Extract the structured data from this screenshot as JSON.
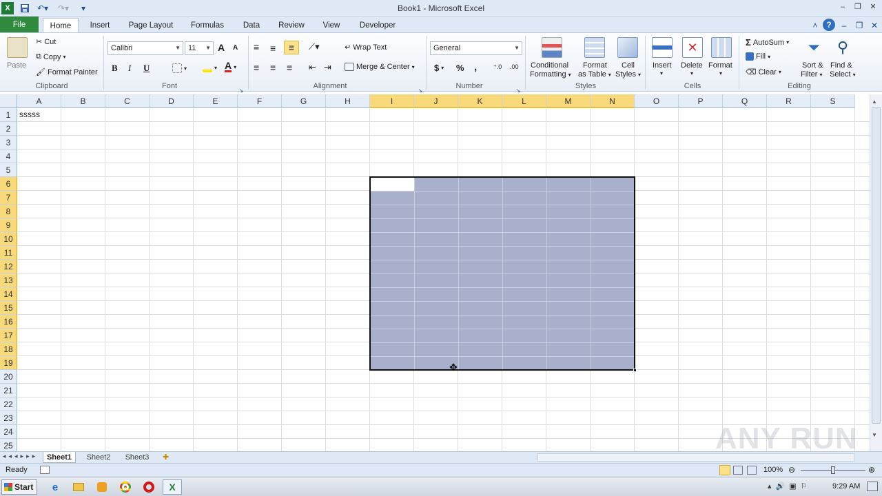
{
  "app": {
    "title": "Book1 - Microsoft Excel",
    "window_controls": [
      "–",
      "❐",
      "✕"
    ]
  },
  "tabs": [
    {
      "label": "File"
    },
    {
      "label": "Home"
    },
    {
      "label": "Insert"
    },
    {
      "label": "Page Layout"
    },
    {
      "label": "Formulas"
    },
    {
      "label": "Data"
    },
    {
      "label": "Review"
    },
    {
      "label": "View"
    },
    {
      "label": "Developer"
    }
  ],
  "ribbon": {
    "clipboard": {
      "paste": "Paste",
      "cut": "Cut",
      "copy": "Copy",
      "format_painter": "Format Painter",
      "label": "Clipboard"
    },
    "font": {
      "name": "Calibri",
      "size": "11",
      "label": "Font",
      "bold": "B",
      "italic": "I",
      "underline": "U",
      "grow": "A",
      "shrink": "A",
      "font_color": "A"
    },
    "alignment": {
      "wrap_text": "Wrap Text",
      "merge_center": "Merge & Center",
      "label": "Alignment"
    },
    "number": {
      "format": "General",
      "currency": "$",
      "percent": "%",
      "comma": ",",
      "label": "Number"
    },
    "styles": {
      "conditional": "Conditional",
      "conditional2": "Formatting",
      "format_as": "Format",
      "format_as2": "as Table",
      "cell": "Cell",
      "cell2": "Styles",
      "label": "Styles"
    },
    "cells": {
      "insert": "Insert",
      "delete": "Delete",
      "format": "Format",
      "label": "Cells"
    },
    "editing": {
      "autosum": "AutoSum",
      "fill": "Fill",
      "clear": "Clear",
      "sort": "Sort &",
      "sort2": "Filter",
      "find": "Find &",
      "find2": "Select",
      "label": "Editing"
    }
  },
  "sheet": {
    "columns": [
      "A",
      "B",
      "C",
      "D",
      "E",
      "F",
      "G",
      "H",
      "I",
      "J",
      "K",
      "L",
      "M",
      "N",
      "O",
      "P",
      "Q",
      "R",
      "S"
    ],
    "rows": [
      "1",
      "2",
      "3",
      "4",
      "5",
      "6",
      "7",
      "8",
      "9",
      "10",
      "11",
      "12",
      "13",
      "14",
      "15",
      "16",
      "17",
      "18",
      "19",
      "20",
      "21",
      "22",
      "23",
      "24",
      "25"
    ],
    "selected_columns": [
      "I",
      "J",
      "K",
      "L",
      "M",
      "N"
    ],
    "selected_rows": [
      "6",
      "7",
      "8",
      "9",
      "10",
      "11",
      "12",
      "13",
      "14",
      "15",
      "16",
      "17",
      "18",
      "19"
    ],
    "cells": {
      "A1": "sssss"
    }
  },
  "sheet_tabs": [
    "Sheet1",
    "Sheet2",
    "Sheet3"
  ],
  "status": {
    "ready": "Ready",
    "zoom": "100%"
  },
  "taskbar": {
    "start": "Start",
    "clock": "9:29 AM"
  },
  "watermark": "ANY RUN"
}
